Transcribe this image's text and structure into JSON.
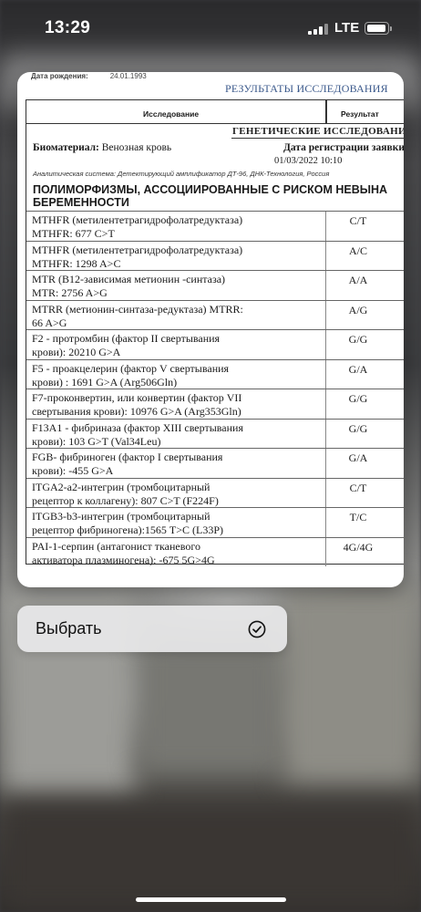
{
  "status_bar": {
    "time": "13:29",
    "network": "LTE"
  },
  "document": {
    "dob_label": "Дата рождения:",
    "dob_value": "24.01.1993",
    "results_title": "РЕЗУЛЬТАТЫ ИССЛЕДОВАНИЯ",
    "header": {
      "study": "Исследование",
      "result": "Результат"
    },
    "genetic_title": "ГЕНЕТИЧЕСКИЕ ИССЛЕДОВАНИЯ",
    "biomaterial_label": "Биоматериал:",
    "biomaterial_value": "Венозная кровь",
    "registration_label": "Дата регистрации заявки:",
    "registration_value": "01/03/2022 10:10",
    "analytical_system": "Аналитическая система: Детектирующий амплификатор ДТ-96, ДНК-Технология, Россия",
    "section_line1": "ПОЛИМОРФИЗМЫ, АССОЦИИРОВАННЫЕ С РИСКОМ НЕВЫНА",
    "section_line2": "БЕРЕМЕННОСТИ",
    "rows": [
      {
        "line1": "MTHFR (метилентетрагидрофолатредуктаза)",
        "line2": "MTHFR: 677 C>T",
        "value": "C/T"
      },
      {
        "line1": "MTHFR (метилентетрагидрофолатредуктаза)",
        "line2": "MTHFR: 1298 A>C",
        "value": "A/C"
      },
      {
        "line1": "MTR (B12-зависимая метионин -синтаза)",
        "line2": "MTR: 2756 A>G",
        "value": "A/A"
      },
      {
        "line1": "MTRR (метионин-синтаза-редуктаза)  MTRR:",
        "line2": "66 A>G",
        "value": "A/G"
      },
      {
        "line1": "F2 - протромбин (фактор II свертывания",
        "line2": "крови): 20210 G>A",
        "value": "G/G"
      },
      {
        "line1": "F5 - проакцелерин (фактор V свертывания",
        "line2": "крови) : 1691 G>A (Arg506Gln)",
        "value": "G/A"
      },
      {
        "line1": "F7-проконвертин, или конвертин (фактор VII",
        "line2": "свертывания крови): 10976 G>A (Arg353Gln)",
        "value": "G/G"
      },
      {
        "line1": "F13A1 - фибриназа (фактор XIII свертывания",
        "line2": "крови): 103 G>T (Val34Leu)",
        "value": "G/G"
      },
      {
        "line1": "FGB- фибриноген (фактор I свертывания",
        "line2": "крови): -455 G>A",
        "value": "G/A"
      },
      {
        "line1": "ITGA2-a2-интегрин (тромбоцитарный",
        "line2": "рецептор к коллагену): 807 C>T (F224F)",
        "value": "C/T"
      },
      {
        "line1": "ITGB3-b3-интегрин (тромбоцитарный",
        "line2": "рецептор фибриногена):1565 T>C (L33P)",
        "value": "T/C"
      },
      {
        "line1": "PAI-1-серпин (антагонист тканевого",
        "line2": "активатора плазминогена): -675 5G>4G",
        "value": "4G/4G"
      }
    ]
  },
  "menu": {
    "select_label": "Выбрать",
    "select_icon": "checkmark-circle-icon"
  }
}
